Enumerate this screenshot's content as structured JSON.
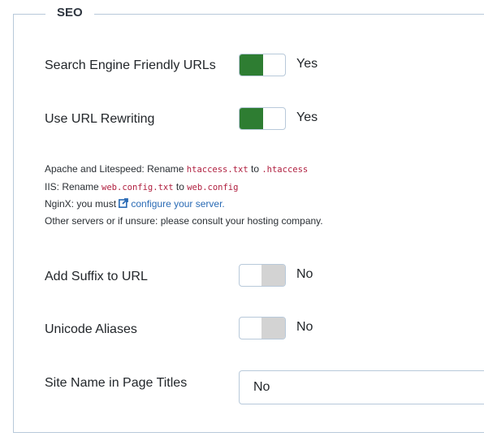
{
  "fieldset": {
    "legend": "SEO"
  },
  "fields": [
    {
      "label": "Search Engine Friendly URLs",
      "state": "Yes",
      "on": true
    },
    {
      "label": "Use URL Rewriting",
      "state": "Yes",
      "on": true
    },
    {
      "label": "Add Suffix to URL",
      "state": "No",
      "on": false
    },
    {
      "label": "Unicode Aliases",
      "state": "No",
      "on": false
    }
  ],
  "notes": {
    "line1_prefix": "Apache and Litespeed: Rename ",
    "line1_code1": "htaccess.txt",
    "line1_mid": " to ",
    "line1_code2": ".htaccess",
    "line2_prefix": "IIS: Rename ",
    "line2_code1": "web.config.txt",
    "line2_mid": " to ",
    "line2_code2": "web.config",
    "line3_prefix": "NginX: you must ",
    "line3_link": "configure your server.",
    "line4": "Other servers or if unsure: please consult your hosting company."
  },
  "site_name": {
    "label": "Site Name in Page Titles",
    "value": "No"
  },
  "colors": {
    "on": "#2e7d32",
    "off": "#d3d3d3",
    "link": "#2a6bb5",
    "border": "#b8c9da"
  }
}
